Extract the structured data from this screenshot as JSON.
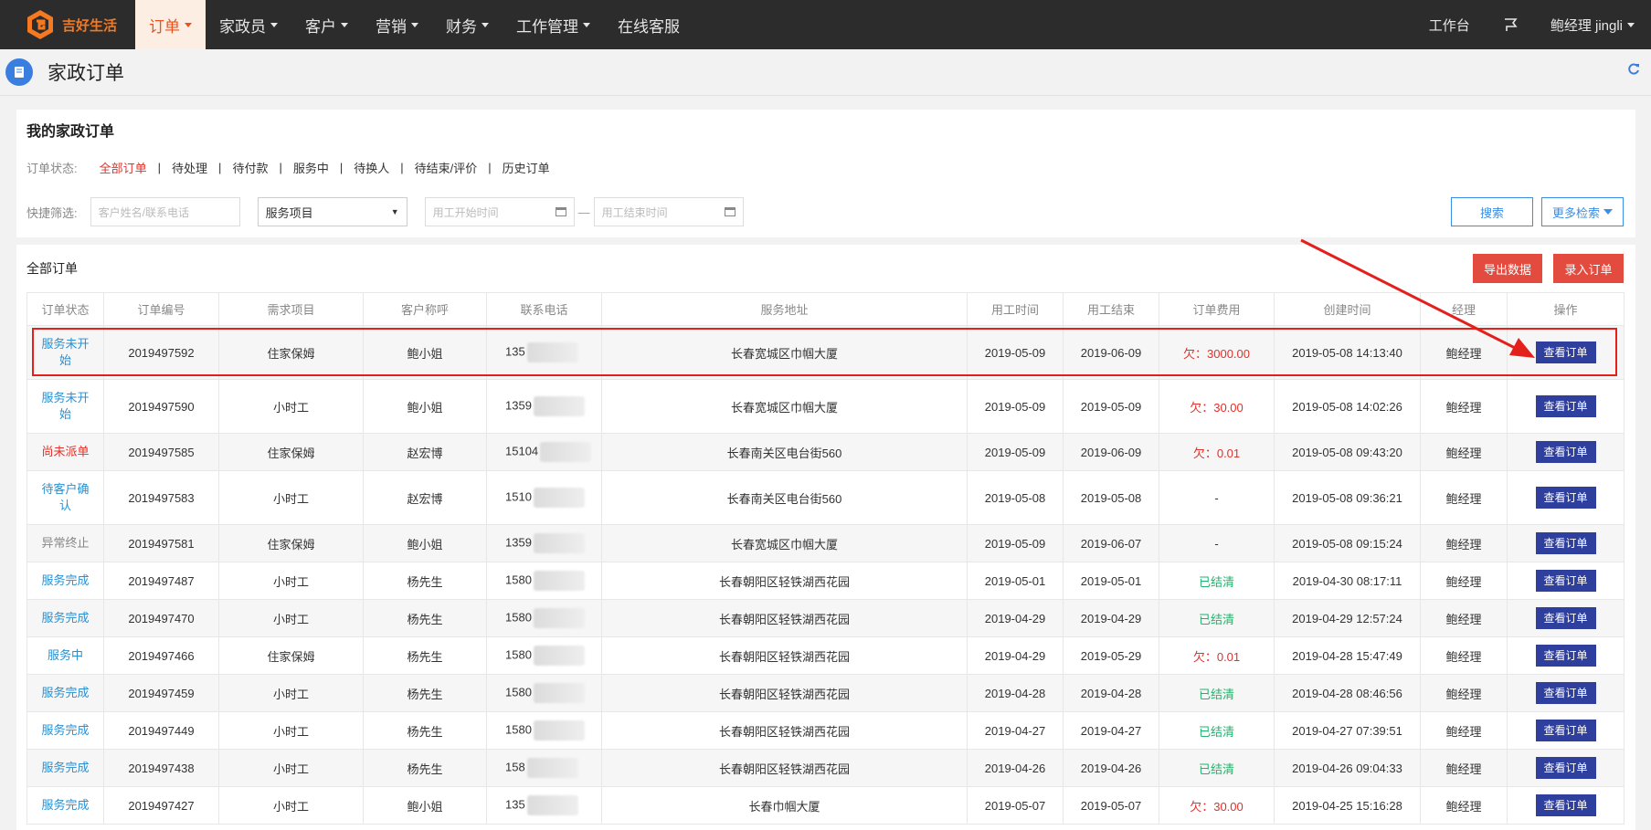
{
  "app": {
    "logo_text": "吉好生活"
  },
  "nav": {
    "items": [
      {
        "label": "订单",
        "caret": true
      },
      {
        "label": "家政员",
        "caret": true
      },
      {
        "label": "客户",
        "caret": true
      },
      {
        "label": "营销",
        "caret": true
      },
      {
        "label": "财务",
        "caret": true
      },
      {
        "label": "工作管理",
        "caret": true
      },
      {
        "label": "在线客服",
        "caret": false
      }
    ],
    "workbench": "工作台",
    "user": "鲍经理  jingli"
  },
  "page": {
    "title": "家政订单"
  },
  "filter": {
    "section_title": "我的家政订单",
    "status_label": "订单状态:",
    "status_tabs": [
      "全部订单",
      "待处理",
      "待付款",
      "服务中",
      "待换人",
      "待结束/评价",
      "历史订单"
    ],
    "quick_label": "快捷筛选:",
    "customer_placeholder": "客户姓名/联系电话",
    "service_select": "服务项目",
    "start_placeholder": "用工开始时间",
    "end_placeholder": "用工结束时间",
    "dash": "—",
    "search_btn": "搜索",
    "more_btn": "更多检索"
  },
  "table_panel": {
    "title": "全部订单",
    "export_btn": "导出数据",
    "add_btn": "录入订单"
  },
  "table": {
    "headers": [
      "订单状态",
      "订单编号",
      "需求项目",
      "客户称呼",
      "联系电话",
      "服务地址",
      "用工时间",
      "用工结束",
      "订单费用",
      "创建时间",
      "经理",
      "操作"
    ],
    "action_label": "查看订单",
    "rows": [
      {
        "status": "服务未开始",
        "status_lines": [
          "服务未开",
          "始"
        ],
        "status_color": "blue",
        "id": "2019497592",
        "item": "住家保姆",
        "customer": "鲍小姐",
        "phone": "135",
        "address": "长春宽城区巾帼大厦",
        "start": "2019-05-09",
        "end": "2019-06-09",
        "fee": "欠：3000.00",
        "fee_color": "red",
        "created": "2019-05-08 14:13:40",
        "manager": "鲍经理",
        "tall": true
      },
      {
        "status": "服务未开始",
        "status_lines": [
          "服务未开",
          "始"
        ],
        "status_color": "blue",
        "id": "2019497590",
        "item": "小时工",
        "customer": "鲍小姐",
        "phone": "1359",
        "address": "长春宽城区巾帼大厦",
        "start": "2019-05-09",
        "end": "2019-05-09",
        "fee": "欠：30.00",
        "fee_color": "red",
        "created": "2019-05-08 14:02:26",
        "manager": "鲍经理",
        "tall": true
      },
      {
        "status": "尚未派单",
        "status_lines": [
          "尚未派单"
        ],
        "status_color": "red",
        "id": "2019497585",
        "item": "住家保姆",
        "customer": "赵宏博",
        "phone": "15104",
        "address": "长春南关区电台街560",
        "start": "2019-05-09",
        "end": "2019-06-09",
        "fee": "欠：0.01",
        "fee_color": "red",
        "created": "2019-05-08 09:43:20",
        "manager": "鲍经理",
        "tall": false
      },
      {
        "status": "待客户确认",
        "status_lines": [
          "待客户确",
          "认"
        ],
        "status_color": "blue",
        "id": "2019497583",
        "item": "小时工",
        "customer": "赵宏博",
        "phone": "1510",
        "address": "长春南关区电台街560",
        "start": "2019-05-08",
        "end": "2019-05-08",
        "fee": "-",
        "fee_color": "plain",
        "created": "2019-05-08 09:36:21",
        "manager": "鲍经理",
        "tall": true
      },
      {
        "status": "异常终止",
        "status_lines": [
          "异常终止"
        ],
        "status_color": "gray",
        "id": "2019497581",
        "item": "住家保姆",
        "customer": "鲍小姐",
        "phone": "1359",
        "address": "长春宽城区巾帼大厦",
        "start": "2019-05-09",
        "end": "2019-06-07",
        "fee": "-",
        "fee_color": "plain",
        "created": "2019-05-08 09:15:24",
        "manager": "鲍经理",
        "tall": false
      },
      {
        "status": "服务完成",
        "status_lines": [
          "服务完成"
        ],
        "status_color": "blue",
        "id": "2019497487",
        "item": "小时工",
        "customer": "杨先生",
        "phone": "1580",
        "address": "长春朝阳区轻铁湖西花园",
        "start": "2019-05-01",
        "end": "2019-05-01",
        "fee": "已结清",
        "fee_color": "green",
        "created": "2019-04-30 08:17:11",
        "manager": "鲍经理",
        "tall": false
      },
      {
        "status": "服务完成",
        "status_lines": [
          "服务完成"
        ],
        "status_color": "blue",
        "id": "2019497470",
        "item": "小时工",
        "customer": "杨先生",
        "phone": "1580",
        "address": "长春朝阳区轻铁湖西花园",
        "start": "2019-04-29",
        "end": "2019-04-29",
        "fee": "已结清",
        "fee_color": "green",
        "created": "2019-04-29 12:57:24",
        "manager": "鲍经理",
        "tall": false
      },
      {
        "status": "服务中",
        "status_lines": [
          "服务中"
        ],
        "status_color": "blue",
        "id": "2019497466",
        "item": "住家保姆",
        "customer": "杨先生",
        "phone": "1580",
        "address": "长春朝阳区轻铁湖西花园",
        "start": "2019-04-29",
        "end": "2019-05-29",
        "fee": "欠：0.01",
        "fee_color": "red",
        "created": "2019-04-28 15:47:49",
        "manager": "鲍经理",
        "tall": false
      },
      {
        "status": "服务完成",
        "status_lines": [
          "服务完成"
        ],
        "status_color": "blue",
        "id": "2019497459",
        "item": "小时工",
        "customer": "杨先生",
        "phone": "1580",
        "address": "长春朝阳区轻铁湖西花园",
        "start": "2019-04-28",
        "end": "2019-04-28",
        "fee": "已结清",
        "fee_color": "green",
        "created": "2019-04-28 08:46:56",
        "manager": "鲍经理",
        "tall": false
      },
      {
        "status": "服务完成",
        "status_lines": [
          "服务完成"
        ],
        "status_color": "blue",
        "id": "2019497449",
        "item": "小时工",
        "customer": "杨先生",
        "phone": "1580",
        "address": "长春朝阳区轻铁湖西花园",
        "start": "2019-04-27",
        "end": "2019-04-27",
        "fee": "已结清",
        "fee_color": "green",
        "created": "2019-04-27 07:39:51",
        "manager": "鲍经理",
        "tall": false
      },
      {
        "status": "服务完成",
        "status_lines": [
          "服务完成"
        ],
        "status_color": "blue",
        "id": "2019497438",
        "item": "小时工",
        "customer": "杨先生",
        "phone": "158",
        "address": "长春朝阳区轻铁湖西花园",
        "start": "2019-04-26",
        "end": "2019-04-26",
        "fee": "已结清",
        "fee_color": "green",
        "created": "2019-04-26 09:04:33",
        "manager": "鲍经理",
        "tall": false
      },
      {
        "status": "服务完成",
        "status_lines": [
          "服务完成"
        ],
        "status_color": "blue",
        "id": "2019497427",
        "item": "小时工",
        "customer": "鲍小姐",
        "phone": "135",
        "address": "长春巾帼大厦",
        "start": "2019-05-07",
        "end": "2019-05-07",
        "fee": "欠：30.00",
        "fee_color": "red",
        "created": "2019-04-25 15:16:28",
        "manager": "鲍经理",
        "tall": false
      }
    ]
  },
  "colors": {
    "nav_bg": "#2c2c2c",
    "accent": "#e8531e",
    "primary_btn": "#2f3f9e",
    "danger_btn": "#e44b3f",
    "highlight": "#e3201b"
  },
  "icons": {
    "logo": "logo-icon",
    "page": "order-book-icon",
    "refresh": "refresh-icon",
    "workbench_flag": "flag-icon",
    "calendar": "calendar-icon",
    "arrow": "annotation-arrow-icon"
  }
}
